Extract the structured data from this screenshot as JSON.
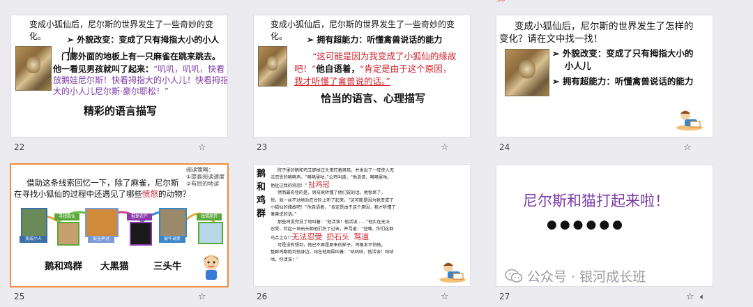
{
  "top_mark": "30",
  "slides": {
    "s22": {
      "number": "22",
      "line1": "变成小狐仙后，尼尔斯的世界发生了一些奇妙的变化。",
      "bullet": "➢ 外貌改变：变成了只有拇指大小的小人儿",
      "p1": "门廊外面的地板上有一只麻雀在跳来跳去。",
      "p2a": "他一看见男孩就叫了起来：",
      "p2b": "“叽叽，叽叽，快看",
      "p3": "放鹅娃尼尔斯！快看拇指大的小人儿！快看拇指",
      "p4": "大的小人儿尼尔斯·豪尔耶松！”",
      "caption": "精彩的语言描写"
    },
    "s23": {
      "number": "23",
      "line1": "变成小狐仙后，尼尔斯的世界发生了一些奇妙的变化。",
      "bullet": "➢ 拥有超能力：听懂禽兽说话的能力",
      "q1": "“这可能是因为我变成了小狐仙的缘故",
      "q2a": "吧！”",
      "q2b": "他自语着，",
      "q2c": "“肯定是由于这个原因，",
      "q3": "我才听懂了禽兽说的话。”",
      "caption": "恰当的语言、心理描写"
    },
    "s24": {
      "number": "24",
      "l1": "变成小狐仙后，尼尔斯的世界发生了怎样的",
      "l2": "变化？请在文中找一找！",
      "b1a": "➢ 外貌改变：变成了只有拇指大小的",
      "b1b": "小人儿",
      "b2": "➢ 拥有超能力：听懂禽兽说话的能力"
    },
    "s25": {
      "number": "25",
      "note1": "阅读策略：",
      "note2": "①提高阅读速度",
      "note3": "②有目的地读",
      "q1": "借助这条线索回忆一下，除了麻雀，尼尔斯",
      "q2a": "在寻找小狐仙的过程中还遇见了哪些",
      "q2b": "愤怒",
      "q2c": "的动物？",
      "tags": [
        "变成小人",
        "寻找狐仙",
        "安全声讨",
        "报复农户",
        "被牛调笑",
        "独骑高开"
      ],
      "ans1": "鹅和鸡群",
      "ans2": "大黑猫",
      "ans3": "三头牛"
    },
    "s26": {
      "number": "26",
      "side_title": [
        "鹅",
        "和",
        "鸡",
        "群"
      ],
      "lines": [
        "院子里的鹅和鸡立即掉过头来盯着男孩，并发出了一阵使人无",
        "法忍受的咯咯声。“咯咯里咕，”公鸡叫道，“他活该，咯咯里咕，",
        "他扯过我的鸡冠！”",
        "然而最奇怪的是，男孩竟听懂了他们说的话。他惊呆了，",
        "惊，就一丝不动地站在台阶上听了起来。“这可能是因为我变成了",
        "小狐仙的缘故吧！”他自语着，“肯定是由于这个原因，我才听懂了",
        "禽兽说的话。”",
        "那些鸡没完没了地叫着：“他活该！他活该……”他实在无法",
        "忍受，捡起一块石头朝他们扔了过去，并骂道：“住嘴，你们这群",
        "乌合之众!”",
        "可是没有想到，他已不再是原来的样子，鸡根本不怕他。",
        "整群鸡都跑到他身边，站在他周围叫着：“咕咕咕，他活该！咕咕",
        "咕，你活该！”"
      ],
      "ann1": "扯鸡冠",
      "ann2": "无法忍受",
      "ann3": "扔石头",
      "ann4": "骂道"
    },
    "s27": {
      "number": "27",
      "title": "尼尔斯和猫打起来啦！",
      "dots": "●●●●●●"
    }
  },
  "watermark": "公众号 · 银河成长班",
  "icons": {
    "star": "star-icon",
    "speaker": "speaker-icon",
    "wechat": "wechat-icon"
  },
  "colors": {
    "selected_border": "#f28b3c",
    "purple": "#7b3aa6",
    "red": "#d0202a"
  }
}
